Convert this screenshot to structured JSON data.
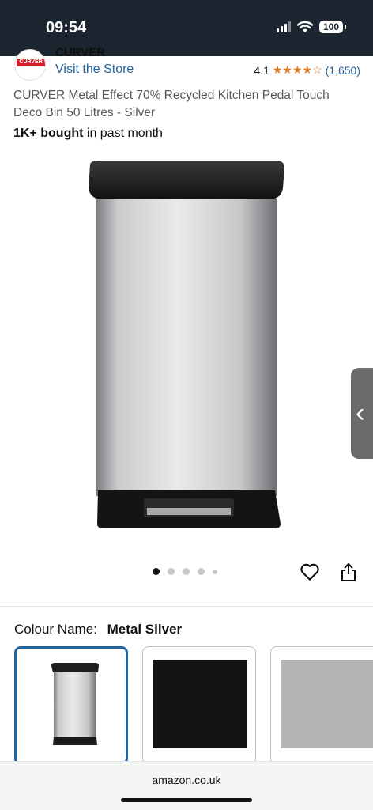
{
  "status": {
    "time": "09:54",
    "battery": "100"
  },
  "brand": {
    "name": "CURVER",
    "logo_text": "CURVER",
    "visit_store": "Visit the Store"
  },
  "rating": {
    "value": "4.1",
    "stars": "★★★★☆",
    "count": "(1,650)"
  },
  "product": {
    "title": "CURVER Metal Effect 70% Recycled Kitchen Pedal Touch Deco Bin 50 Litres - Silver",
    "bought_bold": "1K+ bought",
    "bought_rest": "in past month"
  },
  "carousel": {
    "total_dots": 5,
    "active_index": 0
  },
  "colour": {
    "label": "Colour Name:",
    "selected": "Metal Silver",
    "options": [
      {
        "swatch": "bin-image",
        "selected": true
      },
      {
        "swatch": "#141414"
      },
      {
        "swatch": "#b5b5b5"
      }
    ]
  },
  "browser": {
    "url": "amazon.co.uk"
  },
  "colors": {
    "link": "#2162a1",
    "star": "#de7921",
    "status_bg": "#1b2630"
  },
  "icons": [
    "signal-icon",
    "wifi-icon",
    "battery-icon",
    "chevron-left-icon",
    "heart-icon",
    "share-icon"
  ]
}
